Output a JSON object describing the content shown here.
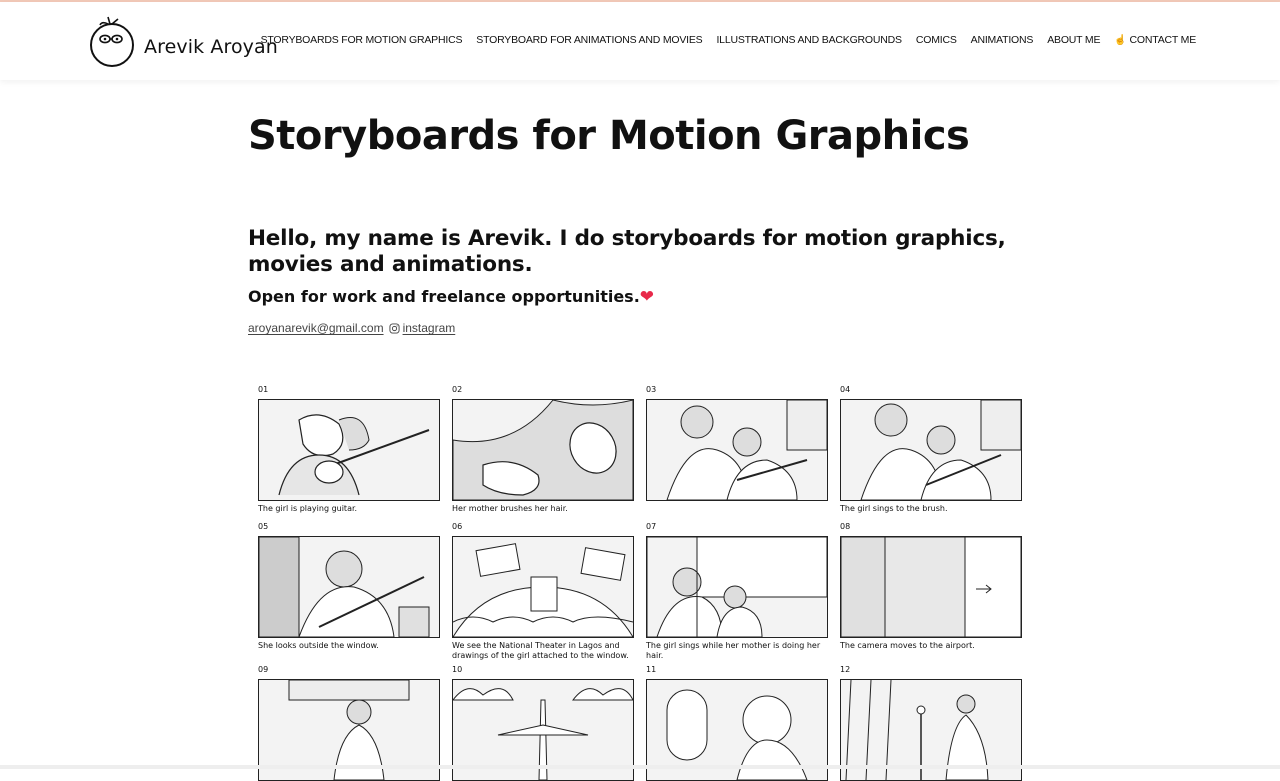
{
  "site": {
    "name": "Arevik Aroyan"
  },
  "nav": {
    "items": [
      "STORYBOARDS FOR MOTION GRAPHICS",
      "STORYBOARD FOR ANIMATIONS AND MOVIES",
      "ILLUSTRATIONS AND BACKGROUNDS",
      "COMICS",
      "ANIMATIONS",
      "ABOUT ME",
      "CONTACT ME"
    ],
    "contact_icon": "pointing-hand-icon"
  },
  "page": {
    "title": "Storyboards for Motion Graphics",
    "intro": "Hello, my name is Arevik. I do storyboards for motion graphics, movies and animations.",
    "sub": "Open for work and freelance opportunities.",
    "sub_icon": "heart-icon",
    "email": "aroyanarevik@gmail.com",
    "instagram": "instagram"
  },
  "storyboard": {
    "frames": [
      {
        "num": "01",
        "caption": "The girl is playing guitar."
      },
      {
        "num": "02",
        "caption": "Her mother brushes her hair."
      },
      {
        "num": "03",
        "caption": ""
      },
      {
        "num": "04",
        "caption": "The girl sings to the brush."
      },
      {
        "num": "05",
        "caption": "She looks outside the window."
      },
      {
        "num": "06",
        "caption": "We see the National Theater in Lagos and drawings of the girl attached to the window."
      },
      {
        "num": "07",
        "caption": "The girl sings while her mother is doing her hair."
      },
      {
        "num": "08",
        "caption": "The camera moves to the airport."
      },
      {
        "num": "09",
        "caption": ""
      },
      {
        "num": "10",
        "caption": ""
      },
      {
        "num": "11",
        "caption": ""
      },
      {
        "num": "12",
        "caption": ""
      }
    ]
  },
  "colors": {
    "heart": "#e8294a",
    "accent_line": "#f2c9b8"
  }
}
